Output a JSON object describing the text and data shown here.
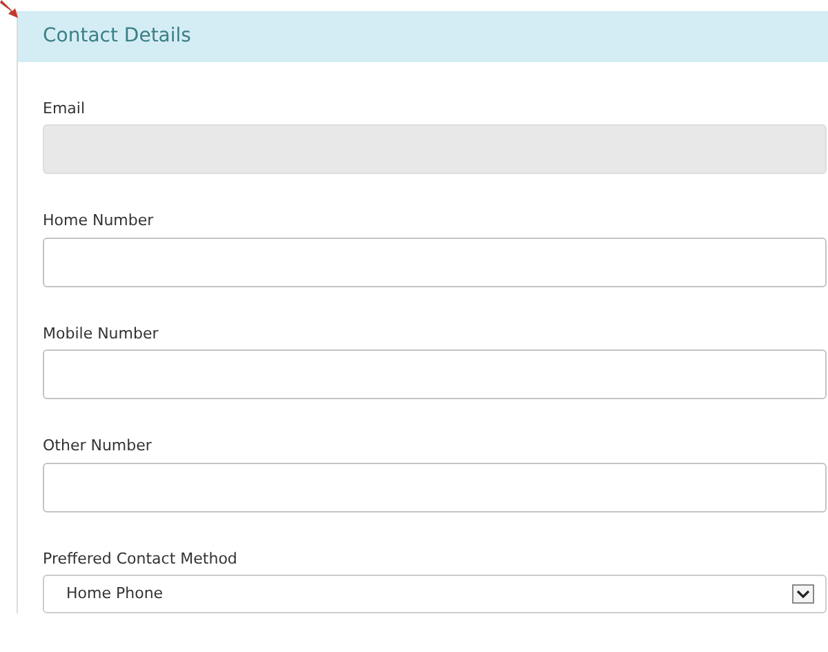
{
  "panel": {
    "title": "Contact Details"
  },
  "fields": [
    {
      "label": "Email",
      "disabled": true
    },
    {
      "label": "Home Number",
      "disabled": false
    },
    {
      "label": "Mobile Number",
      "disabled": false
    },
    {
      "label": "Other Number",
      "disabled": false
    }
  ],
  "contact_method": {
    "label": "Preffered Contact Method",
    "value": "Home Phone"
  }
}
